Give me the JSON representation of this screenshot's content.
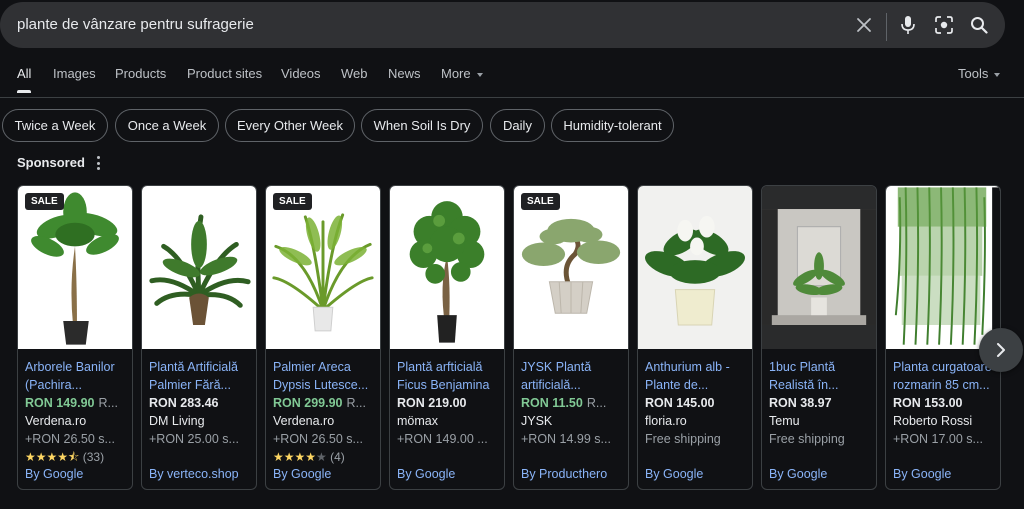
{
  "search": {
    "query": "plante de vânzare pentru sufragerie"
  },
  "tabs": [
    {
      "label": "All",
      "active": true
    },
    {
      "label": "Images"
    },
    {
      "label": "Products"
    },
    {
      "label": "Product sites"
    },
    {
      "label": "Videos"
    },
    {
      "label": "Web"
    },
    {
      "label": "News"
    },
    {
      "label": "More"
    }
  ],
  "tools_label": "Tools",
  "chips": [
    "Twice a Week",
    "Once a Week",
    "Every Other Week",
    "When Soil Is Dry",
    "Daily",
    "Humidity-tolerant"
  ],
  "sponsored_label": "Sponsored",
  "sale_badge": "SALE",
  "products": [
    {
      "title": "Arborele Banilor (Pachira...",
      "price": "RON 149.90",
      "old_price": "R...",
      "on_sale": true,
      "merchant": "Verdena.ro",
      "shipping": "+RON 26.50 s...",
      "rating_stars": "4.5",
      "rating_count": "(33)",
      "by": "By Google"
    },
    {
      "title": "Plantă Artificială Palmier Fără...",
      "price": "RON 283.46",
      "on_sale": false,
      "merchant": "DM Living",
      "shipping": "+RON 25.00 s...",
      "by": "By verteco.shop"
    },
    {
      "title": "Palmier Areca Dypsis Lutesce...",
      "price": "RON 299.90",
      "old_price": "R...",
      "on_sale": true,
      "merchant": "Verdena.ro",
      "shipping": "+RON 26.50 s...",
      "rating_stars": "4",
      "rating_count": "(4)",
      "by": "By Google"
    },
    {
      "title": "Plantă arfticială Ficus Benjamina",
      "price": "RON 219.00",
      "on_sale": false,
      "merchant": "mömax",
      "shipping": "+RON 149.00 ...",
      "by": "By Google"
    },
    {
      "title": "JYSK Plantă artificială...",
      "price": "RON 11.50",
      "old_price": "R...",
      "on_sale": true,
      "merchant": "JYSK",
      "shipping": "+RON 14.99 s...",
      "by": "By Producthero"
    },
    {
      "title": "Anthurium alb - Plante de...",
      "price": "RON 145.00",
      "on_sale": false,
      "merchant": "floria.ro",
      "shipping": "Free shipping",
      "by": "By Google"
    },
    {
      "title": "1buc Plantă Realistă în...",
      "price": "RON 38.97",
      "on_sale": false,
      "merchant": "Temu",
      "shipping": "Free shipping",
      "by": "By Google"
    },
    {
      "title": "Planta curgatoare rozmarin 85 cm...",
      "price": "RON 153.00",
      "on_sale": false,
      "merchant": "Roberto Rossi",
      "shipping": "+RON 17.00 s...",
      "by": "By Google"
    }
  ],
  "colors": {
    "background": "#101114",
    "search_bg": "#303134",
    "link": "#8ab4f8",
    "sale_price": "#81c995",
    "star": "#fdd663"
  }
}
